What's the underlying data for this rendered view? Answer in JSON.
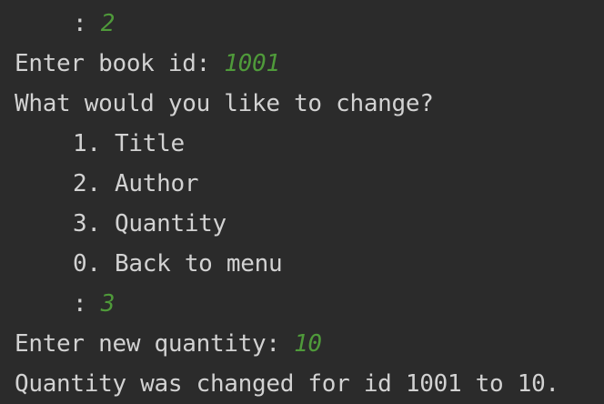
{
  "console": {
    "lines": [
      {
        "prompt": ": ",
        "input": "2"
      },
      {
        "prompt": "Enter book id: ",
        "input": "1001"
      },
      {
        "text": "What would you like to change?"
      },
      {
        "text": "1. Title"
      },
      {
        "text": "2. Author"
      },
      {
        "text": "3. Quantity"
      },
      {
        "text": "0. Back to menu"
      },
      {
        "prompt": ": ",
        "input": "3"
      },
      {
        "prompt": "Enter new quantity: ",
        "input": "10"
      },
      {
        "text": "Quantity was changed for id 1001 to 10."
      }
    ]
  },
  "colors": {
    "background": "#2b2b2b",
    "output_text": "#d2d2d2",
    "user_input": "#4f9a3a"
  }
}
